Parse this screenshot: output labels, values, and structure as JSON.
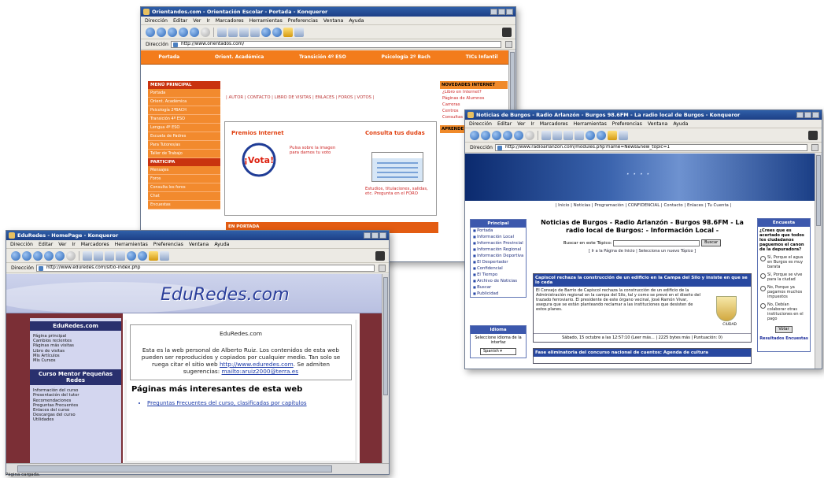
{
  "menu_labels": [
    "Dirección",
    "Editar",
    "Ver",
    "Ir",
    "Marcadores",
    "Herramientas",
    "Preferencias",
    "Ventana",
    "Ayuda"
  ],
  "address_label": "Dirección",
  "windows": {
    "orientados": {
      "title": "Orientandos.com - Orientación Escolar - Portada - Konqueror",
      "url": "http://www.orientados.com/",
      "nav": [
        "Portada",
        "Orient. Académica",
        "Transición 4º ESO",
        "Psicología 2º Bach",
        "TICs Infantil"
      ],
      "left_menu_header": "MENÚ PRINCIPAL",
      "left_menu": [
        "Portada",
        "Orient. Académica",
        "Psicología 2ºBACH",
        "Transición 4º ESO",
        "Lengua 4º ESO",
        "Escuela de Padres",
        "Para Tutores/as",
        "Taller de Trabajo"
      ],
      "participa_header": "PARTICIPA",
      "participa_menu": [
        "Mensajes",
        "Foros",
        "Consulta los foros",
        "Chat",
        "Encuestas"
      ],
      "top_links": "| AUTOR | CONTACTO | LIBRO DE VISITAS | ENLACES | FOROS | VOTOS |",
      "premios_title": "Premios Internet",
      "premios_text": "Pulsa sobre la imagen para darnos tu voto",
      "badge_text": "¡Vota!",
      "consulta_title": "Consulta tus dudas",
      "consulta_text": "Estudios, titulaciones, salidas, etc. Pregunta en el FORO",
      "en_portada": "EN PORTADA",
      "right_header": "NOVEDADES INTERNET",
      "right_links": [
        "¿Libro en Internet?",
        "Páginas de Alumnos",
        "Carreras",
        "Centros",
        "Consultas"
      ],
      "right_header2": "APRENDE"
    },
    "radio": {
      "title": "Noticias de Burgos - Radio Arlanzón - Burgos 98.6FM - La radio local de Burgos - Konqueror",
      "url": "http://www.radioarlanzon.com/modules.php?name=News&new_topic=1",
      "navline": "| Inicio | Noticias | Programación | CONFIDENCIAL | Contacto | Enlaces | Tu Cuenta |",
      "principal_header": "Principal",
      "principal_items": [
        "Portada",
        "Información Local",
        "Información Provincial",
        "Información Regional",
        "Información Deportiva",
        "El Despertador",
        "Confidencial",
        "El Tiempo",
        "Archivo de Noticias",
        "Buscar",
        "Publicidad"
      ],
      "idioma_header": "Idioma",
      "idioma_text": "Seleccione idioma de la interfaz",
      "idioma_value": "Spanish",
      "heading": "Noticias de Burgos - Radio Arlanzón - Burgos 98.6FM - La radio local de Burgos: - Información Local -",
      "search_label": "Buscar en este Tópico:",
      "search_button": "Buscar",
      "search_links": "[ Ir a la Página de Inicio | Selecciona un nuevo Tópico ]",
      "news1_title": "Capiscol rechaza la construcción de un edificio en la Campa del Silo y insiste en que se lo ceda",
      "news1_text": "El Consejo de Barrio de Capiscol rechaza la construcción de un edificio de la Administración regional en la campa del Silo, tal y como se prevé en el diseño del trazado ferroviario. El presidente de este órgano vecinal, José Ramón Vivar, asegura que se están planteando reclamar a las instituciones que desisten de estos planes.",
      "news1_meta": "Sábado, 15 octubre a las 12:57:10 (Leer más... | 2225 bytes más | Puntuación: 0)",
      "news2_title": "Fase eliminatoria del concurso nacional de cuentos: Agenda de cultura",
      "encuesta_header": "Encuesta",
      "encuesta_question": "¿Crees que es acertado que todos los ciudadanos paguemos el canon de la depuradora?",
      "encuesta_options": [
        "Sí, Porque el agua en Burgos es muy barata",
        "Sí, Porque se vive para la ciudad",
        "No, Porque ya pagamos muchos impuestos",
        "No, Debían colaborar otras instituciones en el pago"
      ],
      "vote_button": "Votar",
      "results_link": "Resultados Encuestas",
      "escudo_label": "CIUDAD"
    },
    "eduredes": {
      "title": "EduRedes - HomePage - Konqueror",
      "url": "http://www.eduredes.com/sitio-index.php",
      "logo": "EduRedes.com",
      "side_header1": "EduRedes.com",
      "side_items1": [
        "Página principal",
        "Cambios recientes",
        "Páginas más visitas",
        "Libro de visitas",
        "Mis Artículos",
        "Mis Cursos"
      ],
      "side_header2": "Curso Mentor Pequeñas Redes",
      "side_items2": [
        "Información del curso",
        "Presentación del tutor",
        "Recomendaciones",
        "Preguntas Frecuentes",
        "Enlaces del curso",
        "Descargas del curso",
        "Utilidades"
      ],
      "box_title": "EduRedes.com",
      "box_text": "Esta es la web personal de Alberto Ruiz. Los contenidos de esta web pueden ser reproducidos y copiados por cualquier medio. Tan solo se ruega citar el sitio web",
      "box_link": "http://www.eduredes.com",
      "box_text2": ". Se admiten sugerencias:",
      "box_mail": "mailto:aruiz2000@terra.es",
      "section_title": "Páginas más interesantes de esta web",
      "first_bullet": "Preguntas Frecuentes del curso, clasificadas por capítulos"
    }
  },
  "status_text": "Página cargada."
}
